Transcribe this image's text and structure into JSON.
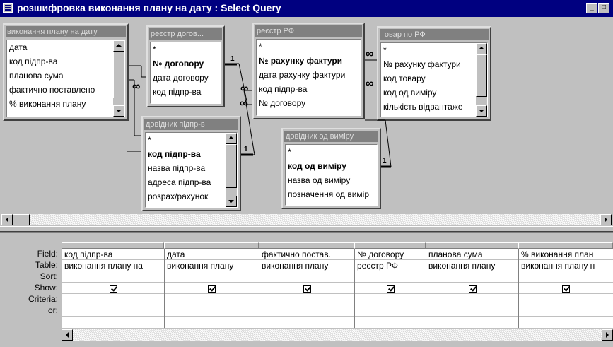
{
  "window": {
    "title": "розшифровка виконання плану на дату : Select Query",
    "minimize_label": "_",
    "maximize_label": "□"
  },
  "tables": [
    {
      "caption": "виконання плану на дату",
      "fields": [
        "дата",
        "код підпр-ва",
        "планова сума",
        "фактично поставлено",
        "% виконання плану"
      ],
      "key_fields": []
    },
    {
      "caption": "реєстр догов...",
      "fields": [
        "*",
        "№ договору",
        "дата договору",
        "код підпр-ва"
      ],
      "key_fields": [
        "№ договору"
      ]
    },
    {
      "caption": "реєстр РФ",
      "fields": [
        "*",
        "№ рахунку фактури",
        "дата рахунку фактури",
        "код підпр-ва",
        "№ договору"
      ],
      "key_fields": [
        "№ рахунку фактури"
      ]
    },
    {
      "caption": "товар по РФ",
      "fields": [
        "*",
        "№ рахунку фактури",
        "код товару",
        "код од виміру",
        "кількість відвантаже"
      ],
      "key_fields": []
    },
    {
      "caption": "довідник підпр-в",
      "fields": [
        "*",
        "код підпр-ва",
        "назва підпр-ва",
        "адреса підпр-ва",
        "розрах/рахунок"
      ],
      "key_fields": [
        "код підпр-ва"
      ]
    },
    {
      "caption": "довідник од виміру",
      "fields": [
        "*",
        "код од виміру",
        "назва од виміру",
        "позначення од вимір"
      ],
      "key_fields": [
        "код од виміру"
      ]
    }
  ],
  "join_labels": {
    "one": "1",
    "many": "∞"
  },
  "grid": {
    "row_labels": [
      "Field:",
      "Table:",
      "Sort:",
      "Show:",
      "Criteria:",
      "or:"
    ],
    "columns": [
      {
        "field": "код підпр-ва",
        "table": "виконання плану на",
        "sort": "",
        "show": true
      },
      {
        "field": "дата",
        "table": "виконання плану",
        "sort": "",
        "show": true
      },
      {
        "field": "фактично постав.",
        "table": "виконання плану",
        "sort": "",
        "show": true
      },
      {
        "field": "№ договору",
        "table": "реєстр РФ",
        "sort": "",
        "show": true
      },
      {
        "field": "планова сума",
        "table": "виконання плану",
        "sort": "",
        "show": true
      },
      {
        "field": "% виконання план",
        "table": "виконання плану н",
        "sort": "",
        "show": true
      }
    ]
  }
}
